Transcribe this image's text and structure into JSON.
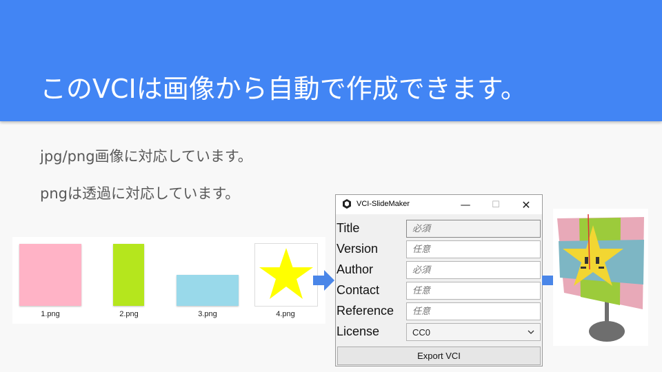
{
  "slide": {
    "title": "このVCIは画像から自動で作成できます。",
    "bullets": [
      "jpg/png画像に対応しています。",
      "pngは透過に対応しています。"
    ],
    "colors": {
      "banner": "#4285f4",
      "background": "#f8f8f8",
      "arrow": "#4a86e8"
    }
  },
  "thumbnails": [
    {
      "label": "1.png",
      "color": "#ffb3c6"
    },
    {
      "label": "2.png",
      "color": "#b5e61d"
    },
    {
      "label": "3.png",
      "color": "#99d9ea"
    },
    {
      "label": "4.png",
      "color": "#ffff00"
    }
  ],
  "dialog": {
    "title": "VCI-SlideMaker",
    "controls": {
      "minimize": "—",
      "maximize": "☐",
      "close": "✕"
    },
    "fields": [
      {
        "label": "Title",
        "placeholder": "必須"
      },
      {
        "label": "Version",
        "placeholder": "任意"
      },
      {
        "label": "Author",
        "placeholder": "必須"
      },
      {
        "label": "Contact",
        "placeholder": "任意"
      },
      {
        "label": "Reference",
        "placeholder": "任意"
      }
    ],
    "license": {
      "label": "License",
      "value": "CC0"
    },
    "export_label": "Export VCI"
  },
  "icons": {
    "app": "unity-icon",
    "arrow": "right-arrow-icon",
    "star": "star-icon",
    "chevron": "chevron-down-icon"
  }
}
